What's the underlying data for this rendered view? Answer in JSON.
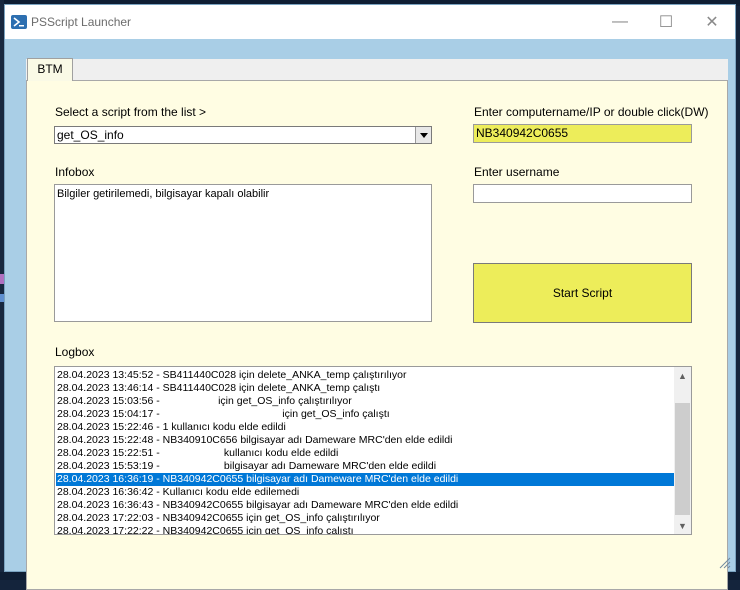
{
  "window": {
    "title": "PSScript Launcher",
    "icon": "powershell-icon",
    "controls": {
      "minimize": "—",
      "maximize": "☐",
      "close": "✕"
    }
  },
  "tabs": [
    {
      "label": "BTM",
      "selected": true
    }
  ],
  "script_select": {
    "label": "Select a script from the list >",
    "value": "get_OS_info"
  },
  "infobox": {
    "label": "Infobox",
    "text": "Bilgiler getirilemedi, bilgisayar kapalı olabilir"
  },
  "computer": {
    "label": "Enter computername/IP or double click(DW)",
    "value": "NB340942C0655",
    "highlight_color": "#eded5a"
  },
  "username": {
    "label": "Enter username",
    "value": ""
  },
  "start_button": {
    "label": "Start Script"
  },
  "logbox": {
    "label": "Logbox",
    "rows": [
      "28.04.2023 13:45:52 - SB411440C028 için delete_ANKA_temp çalıştırılıyor",
      "28.04.2023 13:46:14 - SB411440C028 için delete_ANKA_temp çalıştı",
      "28.04.2023 15:03:56 -                    için get_OS_info çalıştırılıyor",
      "28.04.2023 15:04:17 -                                          için get_OS_info çalıştı",
      "28.04.2023 15:22:46 - 1 kullanıcı kodu elde edildi",
      "28.04.2023 15:22:48 - NB340910C656 bilgisayar adı Dameware MRC'den elde edildi",
      "28.04.2023 15:22:51 -                      kullanıcı kodu elde edildi",
      "28.04.2023 15:53:19 -                      bilgisayar adı Dameware MRC'den elde edildi",
      "28.04.2023 16:36:19 - NB340942C0655 bilgisayar adı Dameware MRC'den elde edildi",
      "28.04.2023 16:36:42 - Kullanıcı kodu elde edilemedi",
      "28.04.2023 16:36:43 - NB340942C0655 bilgisayar adı Dameware MRC'den elde edildi",
      "28.04.2023 17:22:03 - NB340942C0655 için get_OS_info çalıştırılıyor",
      "28.04.2023 17:22:22 - NB340942C0655 için get_OS_info çalıştı"
    ],
    "selected_index": 8,
    "selection_color": "#0078d7"
  }
}
